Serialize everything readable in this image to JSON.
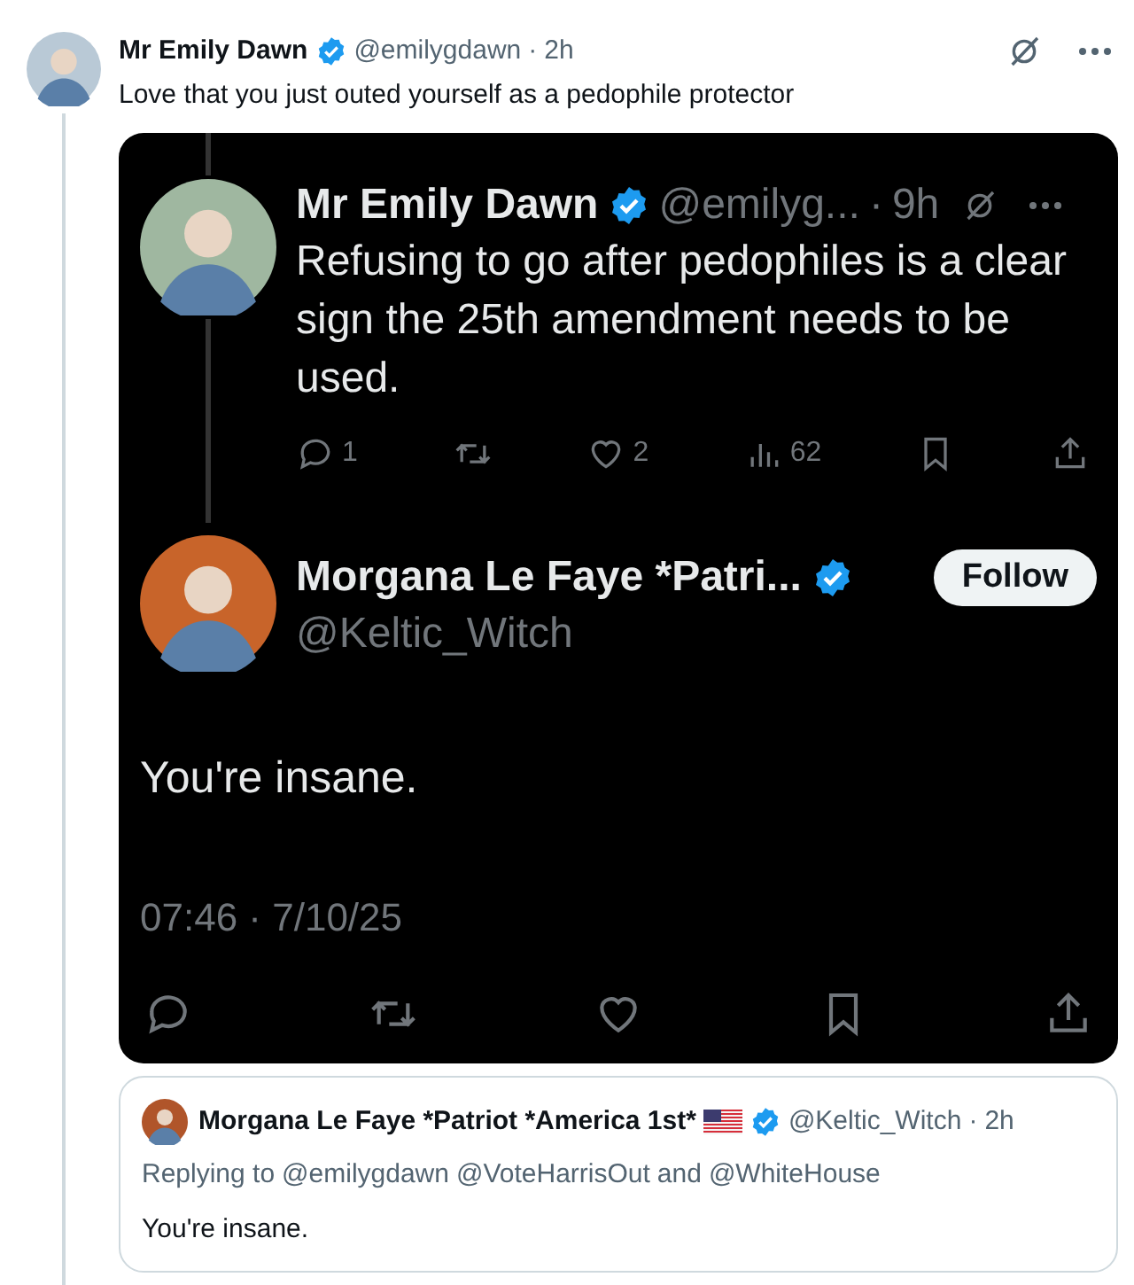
{
  "reply": {
    "name": "Mr Emily Dawn",
    "verified": true,
    "handle": "@emilygdawn",
    "dot": "·",
    "time": "2h",
    "text": "Love that you just outed yourself as a pedophile protector"
  },
  "screenshot": {
    "quoted": {
      "name": "Mr Emily Dawn",
      "verified": true,
      "handle": "@emilyg...",
      "dot": "·",
      "time": "9h",
      "text": "Refusing to go after pedophiles is a clear sign the 25th amendment needs to be used.",
      "actions": [
        {
          "kind": "reply",
          "count": "1"
        },
        {
          "kind": "repost"
        },
        {
          "kind": "like",
          "count": "2"
        },
        {
          "kind": "views",
          "count": "62"
        },
        {
          "kind": "bookmark"
        },
        {
          "kind": "share"
        }
      ]
    },
    "post": {
      "name": "Morgana Le Faye *Patri...",
      "verified": true,
      "handle": "@Keltic_Witch",
      "follow": "Follow",
      "text": "You're insane.",
      "timestamp": "07:46 · 7/10/25",
      "actions": [
        {
          "kind": "reply"
        },
        {
          "kind": "repost"
        },
        {
          "kind": "like"
        },
        {
          "kind": "bookmark"
        },
        {
          "kind": "share"
        }
      ]
    }
  },
  "quote_card": {
    "name": "Morgana Le Faye *Patriot *America 1st*",
    "verified": true,
    "handle": "@Keltic_Witch",
    "dot": "·",
    "time": "2h",
    "replying_prefix": "Replying to",
    "mentions": [
      "@emilygdawn",
      "@VoteHarrisOut"
    ],
    "and": "and",
    "last_mention": "@WhiteHouse",
    "text": "You're insane."
  }
}
